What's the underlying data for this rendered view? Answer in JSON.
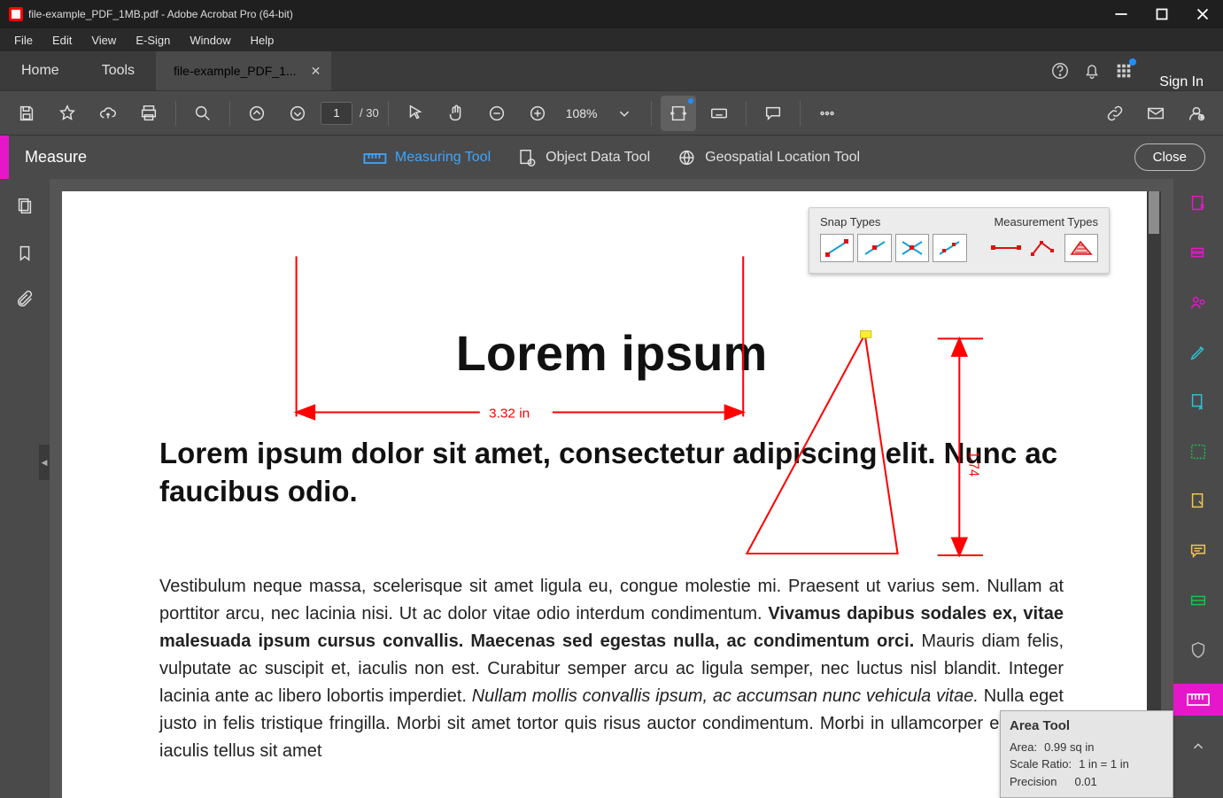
{
  "window": {
    "title": "file-example_PDF_1MB.pdf - Adobe Acrobat Pro (64-bit)"
  },
  "menu": {
    "file": "File",
    "edit": "Edit",
    "view": "View",
    "esign": "E-Sign",
    "window": "Window",
    "help": "Help"
  },
  "tabstrip": {
    "home": "Home",
    "tools": "Tools",
    "doc_tab": "file-example_PDF_1...",
    "signin": "Sign In"
  },
  "toolbar": {
    "page_current": "1",
    "page_total": "/ 30",
    "zoom": "108%"
  },
  "measurebar": {
    "title": "Measure",
    "measuring_tool": "Measuring Tool",
    "object_data_tool": "Object Data Tool",
    "geospatial_tool": "Geospatial Location Tool",
    "close": "Close"
  },
  "snap_panel": {
    "snap_types": "Snap Types",
    "measurement_types": "Measurement Types"
  },
  "doc": {
    "h1": "Lorem ipsum ",
    "h2": "Lorem ipsum dolor sit amet, consectetur adipiscing elit. Nunc ac faucibus odio. ",
    "p_lead": "Vestibulum neque massa, scelerisque sit amet ligula eu, congue molestie mi. Praesent ut varius sem. Nullam at porttitor arcu, nec lacinia nisi. Ut ac dolor vitae odio interdum condimentum. ",
    "p_bold": "Vivamus dapibus sodales ex, vitae malesuada ipsum cursus convallis. Maecenas sed egestas nulla, ac condimentum orci.",
    "p_mid": " Mauris diam felis, vulputate ac suscipit et, iaculis non est. Curabitur semper arcu ac ligula semper, nec luctus nisl blandit. Integer lacinia ante ac libero lobortis imperdiet. ",
    "p_ital": "Nullam mollis convallis ipsum, ac accumsan nunc vehicula vitae.",
    "p_tail": " Nulla eget justo in felis tristique fringilla. Morbi sit amet tortor quis risus auctor condimentum. Morbi in ullamcorper elit. Nulla iaculis tellus sit amet"
  },
  "annot": {
    "dist_label": "3.32 in",
    "height_label": "1.74"
  },
  "area_tip": {
    "title": "Area Tool",
    "area_lbl": "Area:",
    "area_val": "0.99 sq in",
    "scale_lbl": "Scale Ratio:",
    "scale_val": "1 in = 1 in",
    "prec_lbl": "Precision",
    "prec_val": "0.01"
  }
}
